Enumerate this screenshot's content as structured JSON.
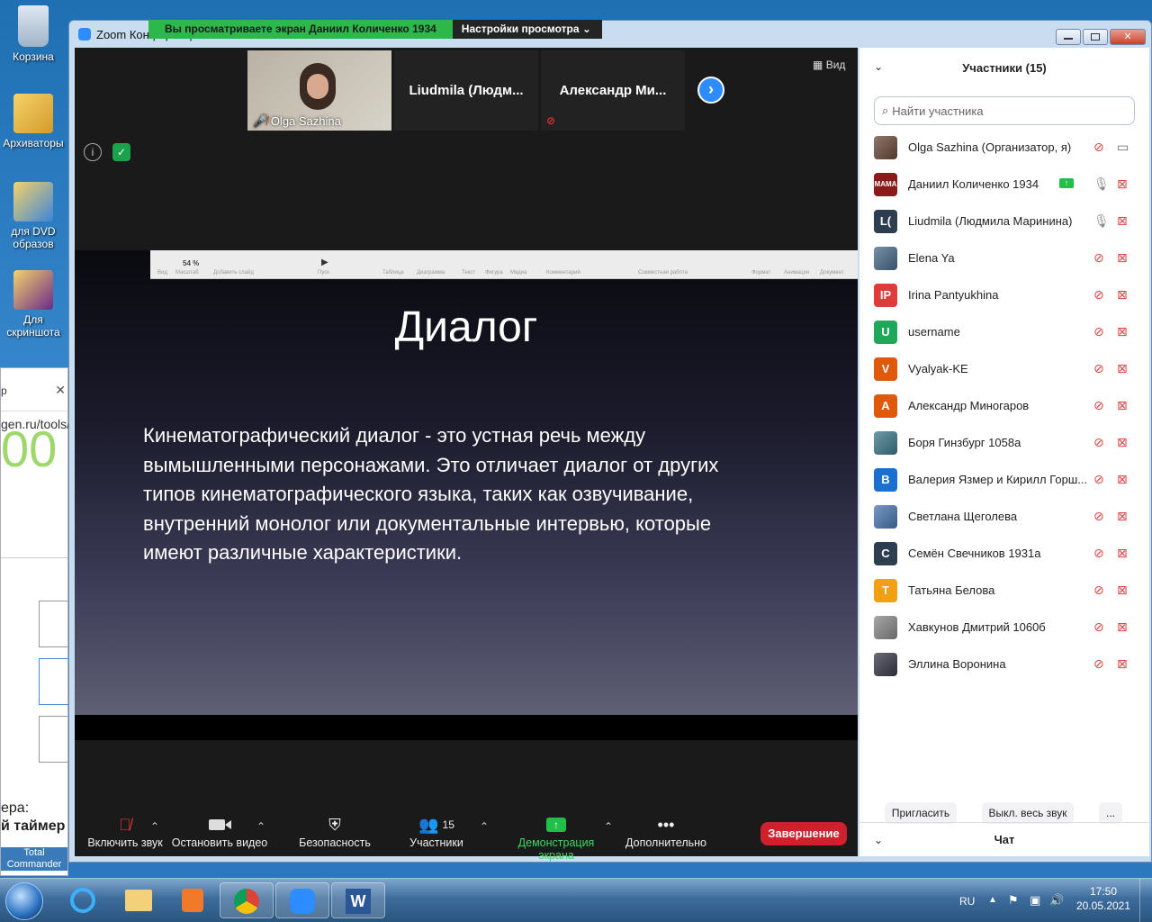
{
  "desktop": {
    "icons": [
      {
        "label": "Корзина",
        "name": "recycle-bin"
      },
      {
        "label": "Архиваторы",
        "name": "archivers-folder"
      },
      {
        "label": "для DVD образов",
        "name": "dvd-images-folder"
      },
      {
        "label": "Для скриншота",
        "name": "screenshot-folder"
      }
    ],
    "bg_partial_url": "gen.ru/tools/",
    "bg_partial_1": "ера:",
    "bg_partial_2": "й таймер",
    "bg_partial_3": "Total Commander"
  },
  "window": {
    "title": "Zoom Конференция",
    "share_banner_text": "Вы просматриваете экран Даниил Количенко 1934",
    "view_settings_label": "Настройки просмотра ⌄"
  },
  "video_strip": {
    "tiles": [
      {
        "name": "Olga Sazhina"
      },
      {
        "name": "Liudmila  (Людм..."
      },
      {
        "name": "Александр  Ми..."
      }
    ],
    "view_label": "Вид"
  },
  "slide": {
    "zoom_level": "54 %",
    "toolbar_labels": [
      "Вид",
      "Масштаб",
      "Добавить слайд",
      "Пуск",
      "Таблица",
      "Диаграмма",
      "Текст",
      "Фигура",
      "Медиа",
      "Комментарий",
      "Совместная работа",
      "Формат",
      "Анимация",
      "Документ"
    ],
    "title": "Диалог",
    "body": "Кинематографический диалог - это устная речь между вымышленными персонажами. Это отличает диалог от других типов кинематографического языка, таких как озвучивание, внутренний монолог или документальные интервью, которые имеют различные характеристики."
  },
  "controls": {
    "unmute": "Включить звук",
    "stop_video": "Остановить видео",
    "security": "Безопасность",
    "participants": "Участники",
    "participants_count": "15",
    "share": "Демонстрация экрана",
    "more": "Дополнительно",
    "end": "Завершение"
  },
  "panel": {
    "header": "Участники (15)",
    "search_placeholder": "Найти участника",
    "participants": [
      {
        "name": "Olga Sazhina (Организатор, я)",
        "initials": "",
        "color": "#6b4a3a"
      },
      {
        "name": "Даниил Количенко 1934",
        "initials": "MAMA",
        "color": "#8b1a1a"
      },
      {
        "name": "Liudmila (Людмила Маринина)",
        "initials": "L(",
        "color": "#2d3e50"
      },
      {
        "name": "Elena Ya",
        "initials": "",
        "color": "#4a6b8a"
      },
      {
        "name": "Irina Pantyukhina",
        "initials": "IP",
        "color": "#e03a3a"
      },
      {
        "name": "username",
        "initials": "U",
        "color": "#1fa85a"
      },
      {
        "name": "Vyalyak-KE",
        "initials": "V",
        "color": "#e0580a"
      },
      {
        "name": "Александр Миногаров",
        "initials": "A",
        "color": "#e0580a"
      },
      {
        "name": "Боря Гинзбург 1058а",
        "initials": "",
        "color": "#3d7a8a"
      },
      {
        "name": "Валерия Язмер и Кирилл Горш...",
        "initials": "B",
        "color": "#1a6fd0"
      },
      {
        "name": "Светлана Щеголева",
        "initials": "",
        "color": "#4a78b0"
      },
      {
        "name": "Семён Свечников 1931а",
        "initials": "C",
        "color": "#2d3e50"
      },
      {
        "name": "Татьяна Белова",
        "initials": "T",
        "color": "#f0a010"
      },
      {
        "name": "Хавкунов Дмитрий 1060б",
        "initials": "",
        "color": "#8a8a8a"
      },
      {
        "name": "Эллина Воронина",
        "initials": "",
        "color": "#3a3a4a"
      }
    ],
    "invite": "Пригласить",
    "mute_all": "Выкл. весь звук",
    "more": "...",
    "chat": "Чат"
  },
  "taskbar": {
    "lang": "RU",
    "time": "17:50",
    "date": "20.05.2021"
  }
}
